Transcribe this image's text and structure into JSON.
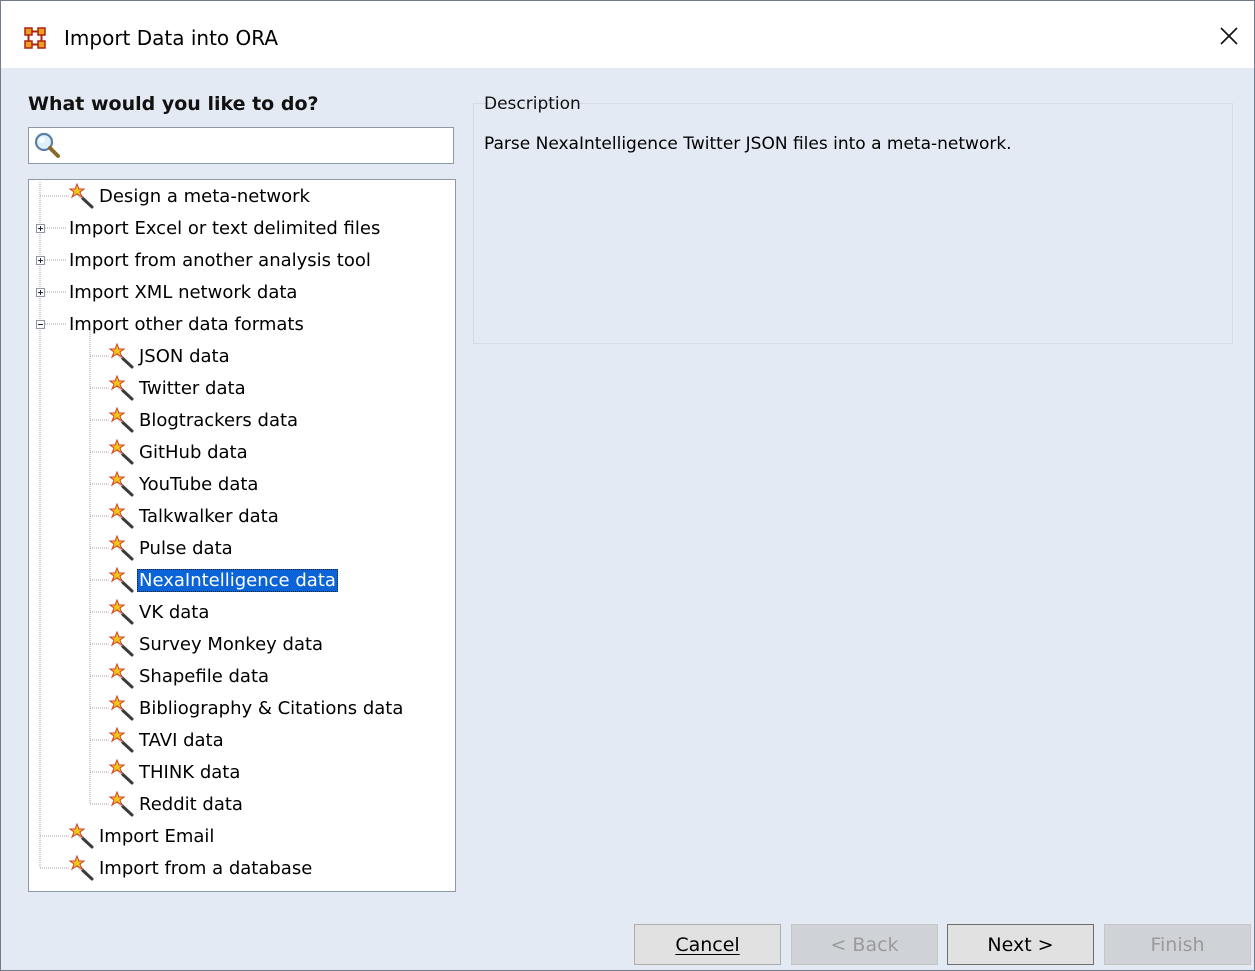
{
  "window": {
    "title": "Import Data into ORA",
    "app_icon": "ora-network-icon",
    "close_icon": "close-icon"
  },
  "left": {
    "heading": "What would you like to do?",
    "search": {
      "value": "",
      "placeholder": "",
      "icon": "search-icon"
    }
  },
  "tree": {
    "items": [
      {
        "label": "Design a meta-network",
        "kind": "leaf",
        "level": 0
      },
      {
        "label": "Import Excel or text delimited files",
        "kind": "folder",
        "expanded": false,
        "level": 0
      },
      {
        "label": "Import from another analysis tool",
        "kind": "folder",
        "expanded": false,
        "level": 0
      },
      {
        "label": "Import XML network data",
        "kind": "folder",
        "expanded": false,
        "level": 0
      },
      {
        "label": "Import other data formats",
        "kind": "folder",
        "expanded": true,
        "level": 0
      },
      {
        "label": "JSON data",
        "kind": "leaf",
        "level": 1
      },
      {
        "label": "Twitter data",
        "kind": "leaf",
        "level": 1
      },
      {
        "label": "Blogtrackers data",
        "kind": "leaf",
        "level": 1
      },
      {
        "label": "GitHub data",
        "kind": "leaf",
        "level": 1
      },
      {
        "label": "YouTube data",
        "kind": "leaf",
        "level": 1
      },
      {
        "label": "Talkwalker data",
        "kind": "leaf",
        "level": 1
      },
      {
        "label": "Pulse data",
        "kind": "leaf",
        "level": 1
      },
      {
        "label": "NexaIntelligence data",
        "kind": "leaf",
        "level": 1,
        "selected": true
      },
      {
        "label": "VK data",
        "kind": "leaf",
        "level": 1
      },
      {
        "label": "Survey Monkey data",
        "kind": "leaf",
        "level": 1
      },
      {
        "label": "Shapefile data",
        "kind": "leaf",
        "level": 1
      },
      {
        "label": "Bibliography & Citations data",
        "kind": "leaf",
        "level": 1
      },
      {
        "label": "TAVI data",
        "kind": "leaf",
        "level": 1
      },
      {
        "label": "THINK data",
        "kind": "leaf",
        "level": 1
      },
      {
        "label": "Reddit data",
        "kind": "leaf",
        "level": 1
      },
      {
        "label": "Import Email",
        "kind": "leaf",
        "level": 0
      },
      {
        "label": "Import from a database",
        "kind": "leaf",
        "level": 0
      }
    ]
  },
  "description": {
    "label": "Description",
    "text": "Parse NexaIntelligence Twitter JSON files into a meta-network."
  },
  "buttons": {
    "cancel": "Cancel",
    "back": "< Back",
    "next": "Next >",
    "finish": "Finish"
  }
}
